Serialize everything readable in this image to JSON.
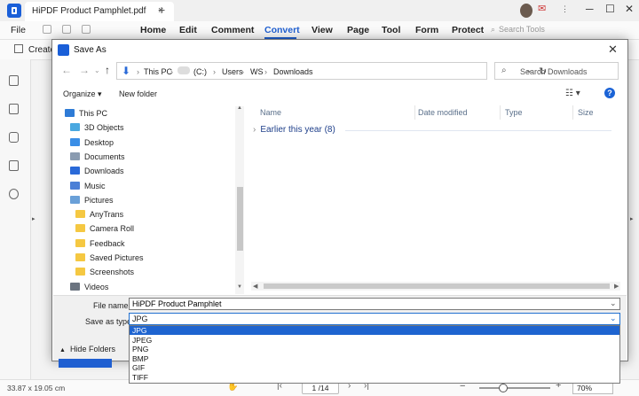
{
  "app": {
    "tab_title": "HiPDF Product Pamphlet.pdf",
    "tab_close": "×",
    "new_tab": "+",
    "window_min": "─",
    "window_max": "☐",
    "window_close": "✕"
  },
  "menubar": {
    "file": "File",
    "items": [
      "Home",
      "Edit",
      "Comment",
      "Convert",
      "View",
      "Page",
      "Tool",
      "Form",
      "Protect"
    ],
    "active": "Convert",
    "search_tools": "Search Tools"
  },
  "toolbar": {
    "create": "Create"
  },
  "statusbar": {
    "size": "33.87 x 19.05 cm",
    "page": "1 /14",
    "zoom": "70%"
  },
  "dialog": {
    "title": "Save As",
    "close": "✕",
    "breadcrumb": [
      "This PC",
      "(C:)",
      "Users",
      "WS",
      "Downloads"
    ],
    "search_placeholder": "Search Downloads",
    "organize": "Organize ▾",
    "new_folder": "New folder",
    "help": "?",
    "nav_items": [
      {
        "label": "This PC",
        "level": 0,
        "icon": "pc-icon"
      },
      {
        "label": "3D Objects",
        "level": 1,
        "icon": "cube-icon"
      },
      {
        "label": "Desktop",
        "level": 1,
        "icon": "desktop-icon"
      },
      {
        "label": "Documents",
        "level": 1,
        "icon": "document-icon"
      },
      {
        "label": "Downloads",
        "level": 1,
        "icon": "download-icon"
      },
      {
        "label": "Music",
        "level": 1,
        "icon": "music-icon"
      },
      {
        "label": "Pictures",
        "level": 1,
        "icon": "pictures-icon"
      },
      {
        "label": "AnyTrans",
        "level": 2,
        "icon": "folder-icon"
      },
      {
        "label": "Camera Roll",
        "level": 2,
        "icon": "folder-icon"
      },
      {
        "label": "Feedback",
        "level": 2,
        "icon": "folder-icon"
      },
      {
        "label": "Saved Pictures",
        "level": 2,
        "icon": "folder-icon"
      },
      {
        "label": "Screenshots",
        "level": 2,
        "icon": "folder-icon"
      },
      {
        "label": "Videos",
        "level": 1,
        "icon": "video-icon"
      }
    ],
    "columns": [
      "Name",
      "Date modified",
      "Type",
      "Size"
    ],
    "group": "Earlier this year (8)",
    "file_name_label": "File name:",
    "file_name_value": "HiPDF Product Pamphlet",
    "save_as_type_label": "Save as type:",
    "save_as_type_value": "JPG",
    "type_options": [
      "JPG",
      "JPEG",
      "PNG",
      "BMP",
      "GIF",
      "TIFF"
    ],
    "hide_folders": "Hide Folders"
  },
  "colors": {
    "accent": "#1f5fd1",
    "selection": "#1e64d0",
    "folder": "#f5c842"
  }
}
